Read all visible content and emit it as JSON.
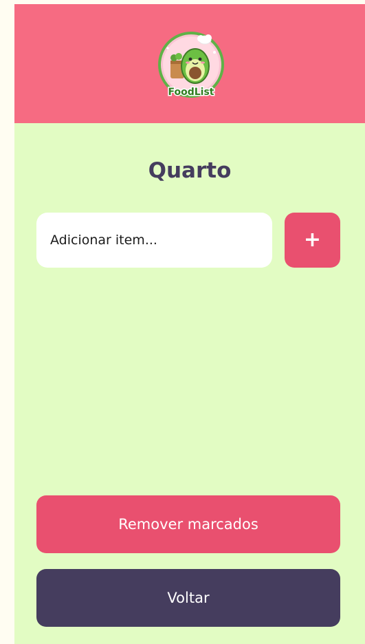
{
  "header": {
    "logo_text": "FoodList",
    "logo_icon": "avocado-chef-icon",
    "background": "#f66b82"
  },
  "main": {
    "title": "Quarto",
    "input": {
      "placeholder": "Adicionar item...",
      "value": ""
    },
    "add_label": "+",
    "items": [],
    "remove_label": "Remover marcados",
    "back_label": "Voltar"
  },
  "colors": {
    "page_bg": "#e2fcc3",
    "accent": "#e9506f",
    "dark": "#453d5e"
  }
}
